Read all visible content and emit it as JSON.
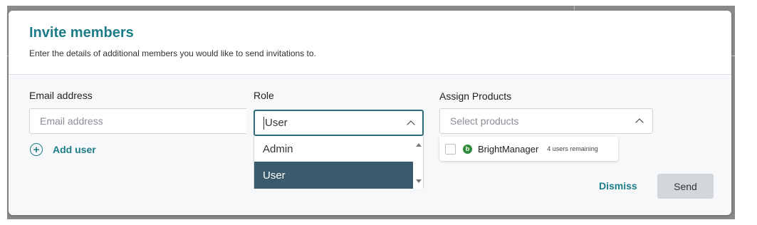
{
  "modal": {
    "title": "Invite members",
    "subtitle": "Enter the details of additional members you would like to send invitations to."
  },
  "email": {
    "label": "Email address",
    "placeholder": "Email address",
    "value": ""
  },
  "add_user": {
    "label": "Add user"
  },
  "role": {
    "label": "Role",
    "value": "User",
    "options": [
      {
        "label": "Admin",
        "selected": false
      },
      {
        "label": "User",
        "selected": true
      }
    ]
  },
  "products": {
    "label": "Assign Products",
    "placeholder": "Select products",
    "items": [
      {
        "name": "BrightManager",
        "remaining": "4 users remaining",
        "logo_letter": "b",
        "checked": false
      }
    ]
  },
  "actions": {
    "dismiss_label": "Dismiss",
    "send_label": "Send"
  },
  "colors": {
    "accent": "#1d7c87",
    "selected_option_bg": "#3a5a6e",
    "send_button_bg": "#d3d6da",
    "product_logo": "#2f8a3a"
  }
}
